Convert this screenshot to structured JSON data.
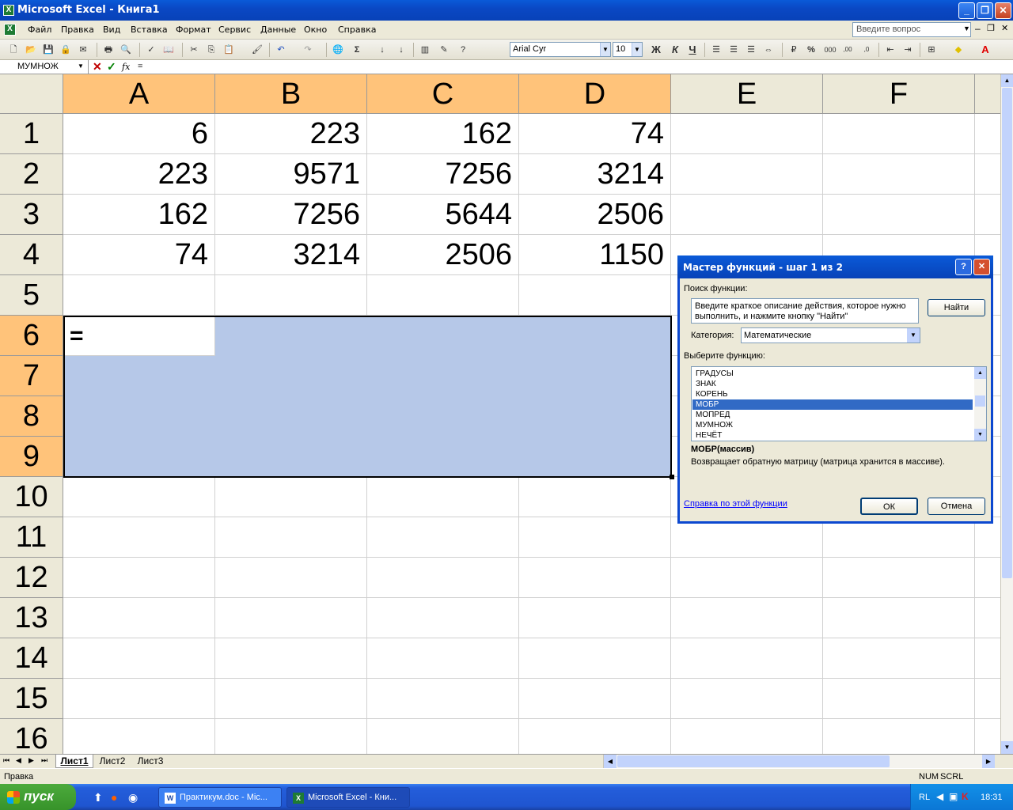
{
  "window": {
    "title": "Microsoft Excel - Книга1",
    "min": "_",
    "restore": "❐",
    "close": "✕"
  },
  "menu": {
    "items": [
      "Файл",
      "Правка",
      "Вид",
      "Вставка",
      "Формат",
      "Сервис",
      "Данные",
      "Окно",
      "Справка"
    ],
    "ask_placeholder": "Введите вопрос"
  },
  "toolbar": {
    "font": "Arial Cyr",
    "size": "10",
    "bold": "Ж",
    "italic": "К",
    "underline": "Ч"
  },
  "formula": {
    "name_box": "МУМНОЖ",
    "cancel": "✕",
    "enter": "✓",
    "fx": "fx",
    "content": "="
  },
  "grid": {
    "columns": [
      "A",
      "B",
      "C",
      "D",
      "E",
      "F"
    ],
    "rows": [
      "1",
      "2",
      "3",
      "4",
      "5",
      "6",
      "7",
      "8",
      "9",
      "10",
      "11",
      "12",
      "13",
      "14",
      "15",
      "16"
    ],
    "data": [
      [
        "6",
        "223",
        "162",
        "74"
      ],
      [
        "223",
        "9571",
        "7256",
        "3214"
      ],
      [
        "162",
        "7256",
        "5644",
        "2506"
      ],
      [
        "74",
        "3214",
        "2506",
        "1150"
      ]
    ],
    "active_cell_text": "="
  },
  "dialog": {
    "title": "Мастер функций - шаг 1 из 2",
    "help": "?",
    "close": "✕",
    "search_label": "Поиск функции:",
    "search_text": "Введите краткое описание действия, которое нужно выполнить, и нажмите кнопку \"Найти\"",
    "find_button": "Найти",
    "category_label": "Категория:",
    "category_value": "Математические",
    "select_label": "Выберите функцию:",
    "functions": [
      "ГРАДУСЫ",
      "ЗНАК",
      "КОРЕНЬ",
      "МОБР",
      "МОПРЕД",
      "МУМНОЖ",
      "НЕЧЁТ"
    ],
    "selected_function": "МОБР",
    "signature": "МОБР(массив)",
    "description": "Возвращает обратную матрицу (матрица хранится в массиве).",
    "help_link": "Справка по этой функции",
    "ok": "ОК",
    "cancel": "Отмена"
  },
  "sheets": {
    "tabs": [
      "Лист1",
      "Лист2",
      "Лист3"
    ],
    "active": "Лист1"
  },
  "status": {
    "left": "Правка",
    "num": "NUM",
    "scrl": "SCRL"
  },
  "taskbar": {
    "start": "пуск",
    "buttons": [
      "Практикум.doc - Mic...",
      "Microsoft Excel - Кни..."
    ],
    "lang": "RL",
    "time": "18:31"
  }
}
